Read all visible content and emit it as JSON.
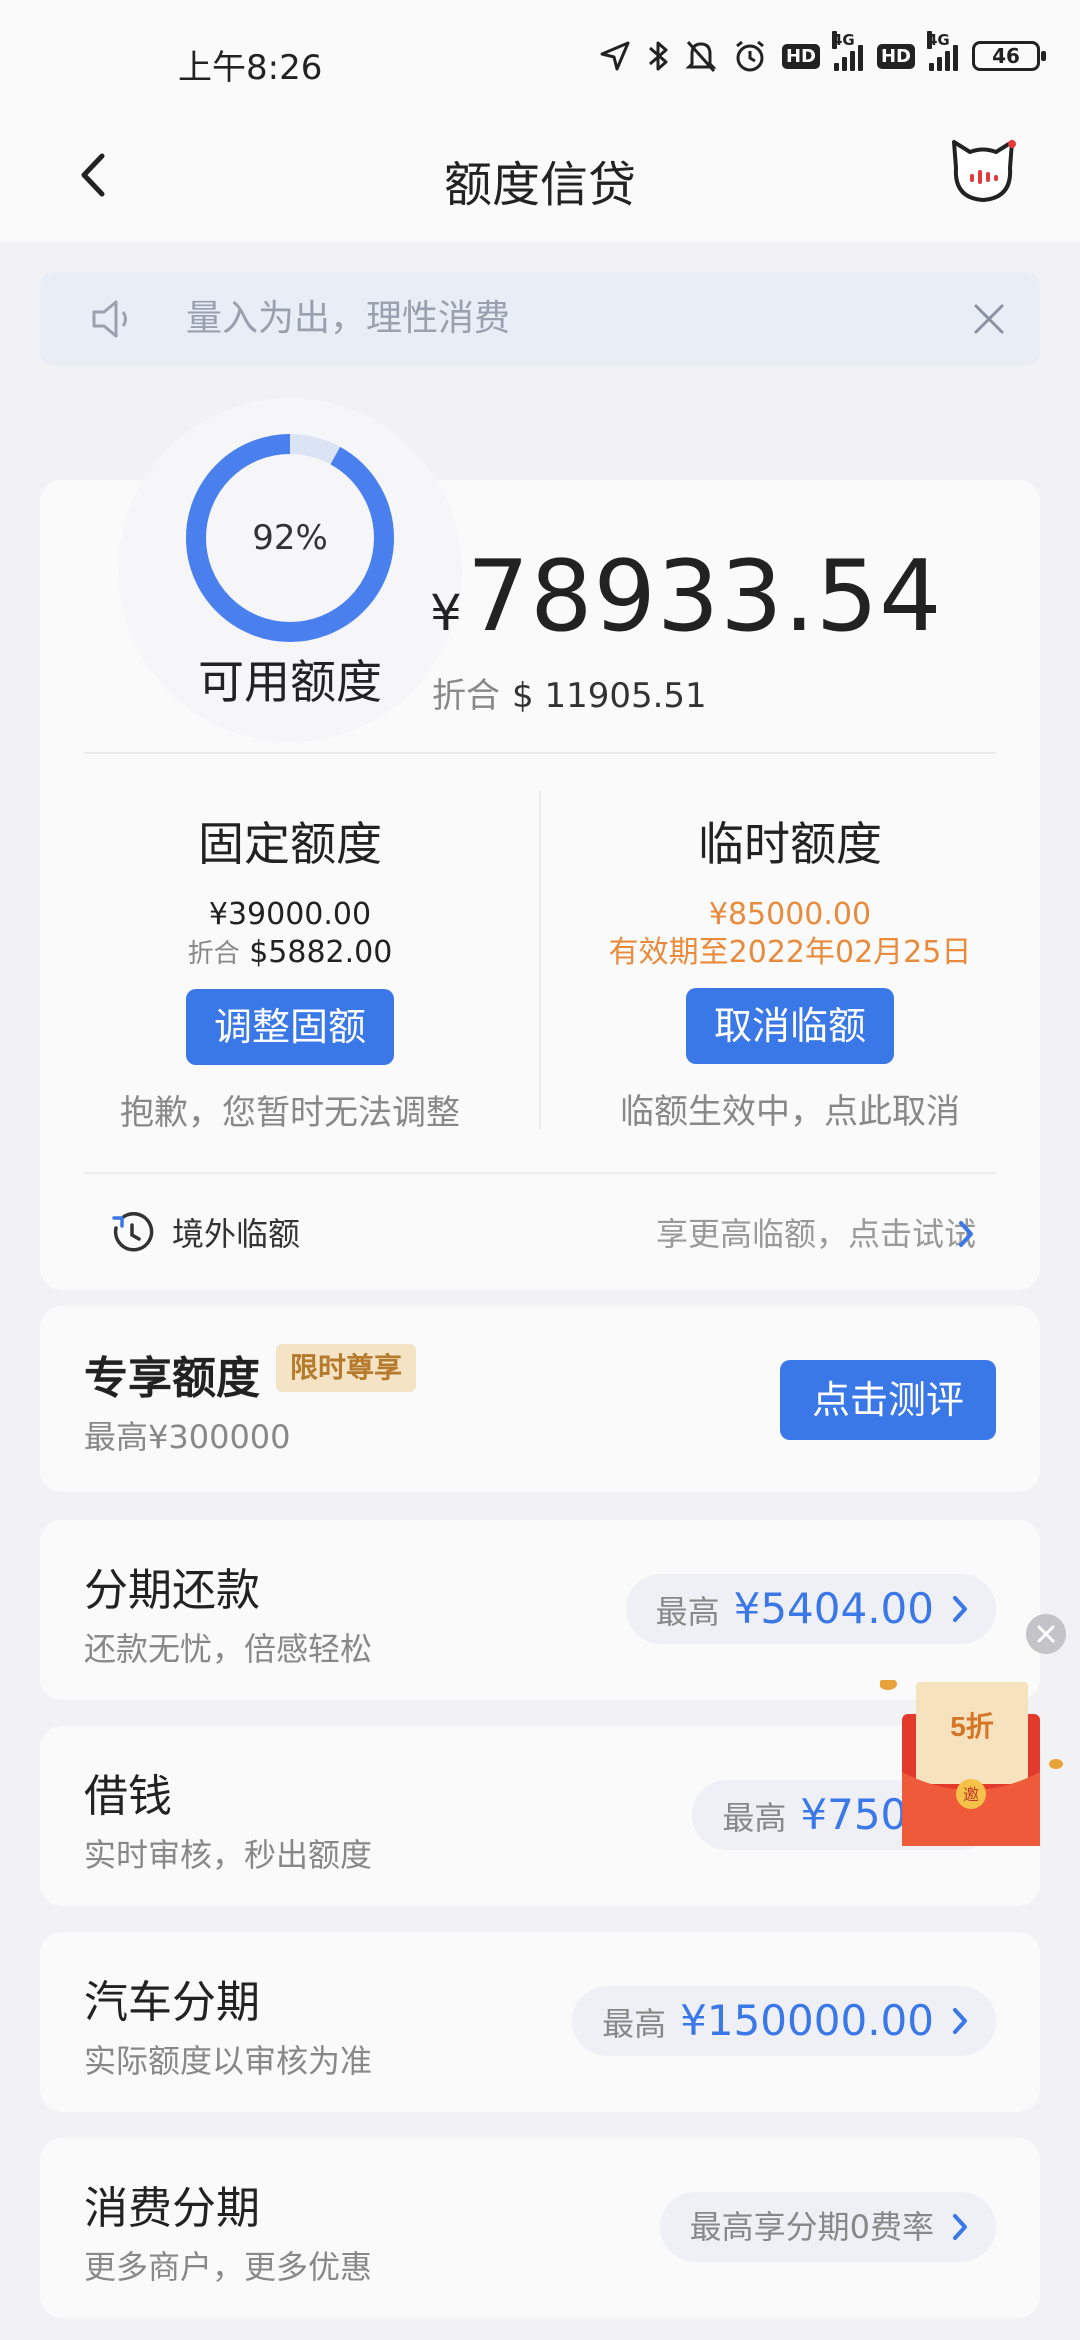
{
  "status": {
    "time": "上午8:26",
    "hd1": "HD",
    "net1": "4G",
    "hd2": "HD",
    "net2": "4G",
    "battery": "46"
  },
  "header": {
    "title": "额度信贷"
  },
  "notice": {
    "text": "量入为出，理性消费"
  },
  "credit": {
    "percent": "92%",
    "percent_value": 92,
    "available_label": "可用额度",
    "currency_symbol": "¥",
    "available_amount": "78933.54",
    "convert_label": "折合",
    "convert_amount": "$ 11905.51",
    "fixed": {
      "title": "固定额度",
      "amount": "¥39000.00",
      "convert_label": "折合",
      "convert_amount": "$5882.00",
      "button": "调整固额",
      "note": "抱歉，您暂时无法调整"
    },
    "temp": {
      "title": "临时额度",
      "amount": "¥85000.00",
      "validity": "有效期至2022年02月25日",
      "button": "取消临额",
      "note": "临额生效中，点此取消"
    },
    "overseas": {
      "label": "境外临额",
      "tip": "享更高临额，点击试试"
    }
  },
  "exclusive": {
    "title": "专享额度",
    "badge": "限时尊享",
    "sub": "最高¥300000",
    "button": "点击测评"
  },
  "services": [
    {
      "title": "分期还款",
      "sub": "还款无忧，倍感轻松",
      "label": "最高",
      "value": "¥5404.00"
    },
    {
      "title": "借钱",
      "sub": "实时审核，秒出额度",
      "label": "最高",
      "value": "¥7500"
    },
    {
      "title": "汽车分期",
      "sub": "实际额度以审核为准",
      "label": "最高",
      "value": "¥150000.00"
    },
    {
      "title": "消费分期",
      "sub": "更多商户，更多优惠",
      "plain": "最高享分期0费率"
    }
  ],
  "promo": {
    "discount": "5折",
    "seal": "邀"
  },
  "colors": {
    "accent": "#3b78e7",
    "orange": "#e98b3c",
    "badge_bg": "#f4e3c4",
    "background": "#f2f2f4"
  }
}
